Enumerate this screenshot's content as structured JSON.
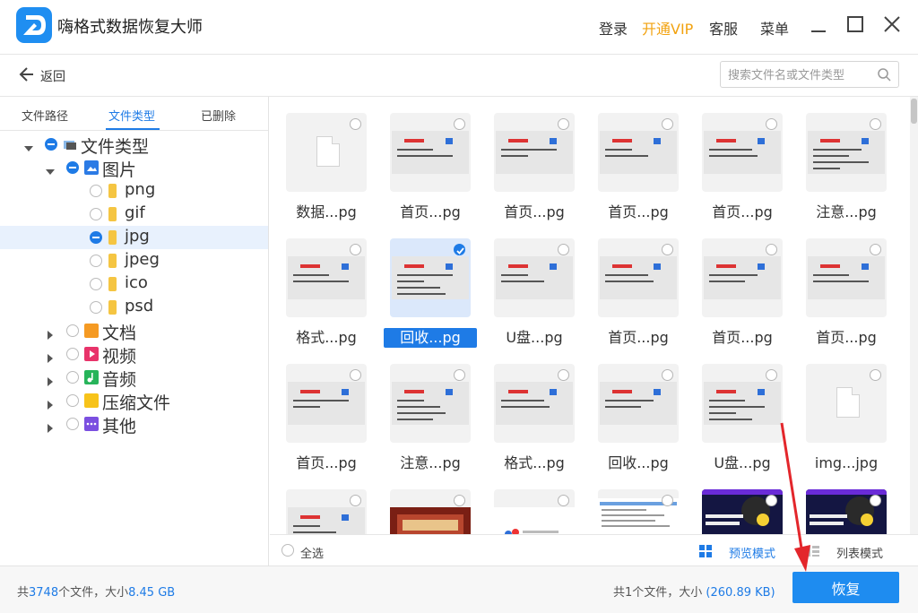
{
  "app": {
    "title": "嗨格式数据恢复大师",
    "login": "登录",
    "vip": "开通VIP",
    "support": "客服",
    "menu": "菜单",
    "brand_color": "#1f8ef1",
    "vip_color": "#f2a20f"
  },
  "backbar": {
    "back_label": "返回",
    "search_placeholder": "搜索文件名或文件类型"
  },
  "tabs": [
    {
      "label": "文件路径",
      "active": false
    },
    {
      "label": "文件类型",
      "active": true
    },
    {
      "label": "已删除",
      "active": false
    }
  ],
  "tree": {
    "root": "文件类型",
    "images": "图片",
    "image_types": [
      "png",
      "gif",
      "jpg",
      "jpeg",
      "ico",
      "psd"
    ],
    "selected_type": "jpg",
    "categories": [
      "文档",
      "视频",
      "音频",
      "压缩文件",
      "其他"
    ]
  },
  "files": [
    {
      "name": "数据...pg",
      "thumb": "blank",
      "checked": false
    },
    {
      "name": "首页...pg",
      "thumb": "doc",
      "checked": false
    },
    {
      "name": "首页...pg",
      "thumb": "doc",
      "checked": false
    },
    {
      "name": "首页...pg",
      "thumb": "doc",
      "checked": false
    },
    {
      "name": "首页...pg",
      "thumb": "doc",
      "checked": false
    },
    {
      "name": "注意...pg",
      "thumb": "list",
      "checked": false
    },
    {
      "name": "格式...pg",
      "thumb": "doc",
      "checked": false
    },
    {
      "name": "回收...pg",
      "thumb": "list",
      "checked": true
    },
    {
      "name": "U盘...pg",
      "thumb": "doc",
      "checked": false
    },
    {
      "name": "首页...pg",
      "thumb": "doc",
      "checked": false
    },
    {
      "name": "首页...pg",
      "thumb": "doc",
      "checked": false
    },
    {
      "name": "首页...pg",
      "thumb": "doc",
      "checked": false
    },
    {
      "name": "首页...pg",
      "thumb": "doc",
      "checked": false
    },
    {
      "name": "注意...pg",
      "thumb": "list",
      "checked": false
    },
    {
      "name": "格式...pg",
      "thumb": "doc",
      "checked": false
    },
    {
      "name": "回收...pg",
      "thumb": "doc",
      "checked": false
    },
    {
      "name": "U盘...pg",
      "thumb": "list",
      "checked": false
    },
    {
      "name": "img...jpg",
      "thumb": "blank",
      "checked": false
    },
    {
      "name": "",
      "thumb": "doc",
      "checked": false
    },
    {
      "name": "",
      "thumb": "photo",
      "checked": false
    },
    {
      "name": "",
      "thumb": "web",
      "checked": false
    },
    {
      "name": "",
      "thumb": "screen",
      "checked": false
    },
    {
      "name": "",
      "thumb": "poster",
      "checked": false
    },
    {
      "name": "",
      "thumb": "poster",
      "checked": false
    }
  ],
  "bottom": {
    "select_all": "全选",
    "preview_mode": "预览模式",
    "list_mode": "列表模式"
  },
  "status": {
    "total_prefix": "共",
    "total_count": "3748",
    "total_mid": "个文件，大小",
    "total_size": "8.45 GB",
    "selected_prefix": "共1个文件，大小",
    "selected_size": "(260.89 KB)",
    "recover": "恢复"
  }
}
